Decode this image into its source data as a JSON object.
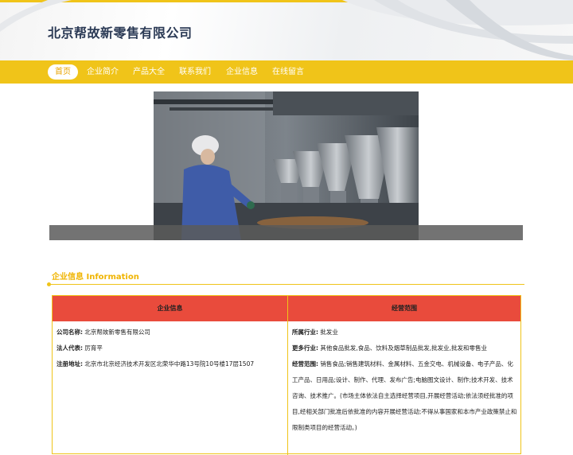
{
  "site": {
    "title": "北京帮故新零售有限公司"
  },
  "nav": {
    "items": [
      {
        "label": "首页",
        "active": true
      },
      {
        "label": "企业简介"
      },
      {
        "label": "产品大全"
      },
      {
        "label": "联系我们"
      },
      {
        "label": "企业信息"
      },
      {
        "label": "在线留言"
      }
    ]
  },
  "section": {
    "title": "企业信息 Information"
  },
  "table": {
    "left_header": "企业信息",
    "right_header": "经营范围",
    "company_name_label": "公司名称:",
    "company_name": "北京帮故新零售有限公司",
    "legal_rep_label": "法人代表:",
    "legal_rep": "厉育平",
    "address_label": "注册地址:",
    "address": "北京市北京经济技术开发区北荣华中路13号院10号楼17层1507",
    "industry_label": "所属行业:",
    "industry": "批发业",
    "more_industry_label": "更多行业:",
    "more_industry": "其他食品批发,食品、饮料及烟草制品批发,批发业,批发和零售业",
    "scope_label": "经营范围:",
    "scope": "销售食品;销售建筑材料、金属材料、五金交电、机械设备、电子产品、化工产品、日用品;设计、制作、代理、发布广告;电脑图文设计、制作;技术开发、技术咨询、技术推广。(市场主体依法自主选择经营项目,开展经营活动;依法须经批准的项目,经相关部门批准后依批准的内容开展经营活动;不得从事国家和本市产业政策禁止和限制类项目的经营活动。)"
  },
  "colors": {
    "accent": "#f0c419",
    "table_header": "#e94b3c",
    "title": "#2b3a55"
  }
}
